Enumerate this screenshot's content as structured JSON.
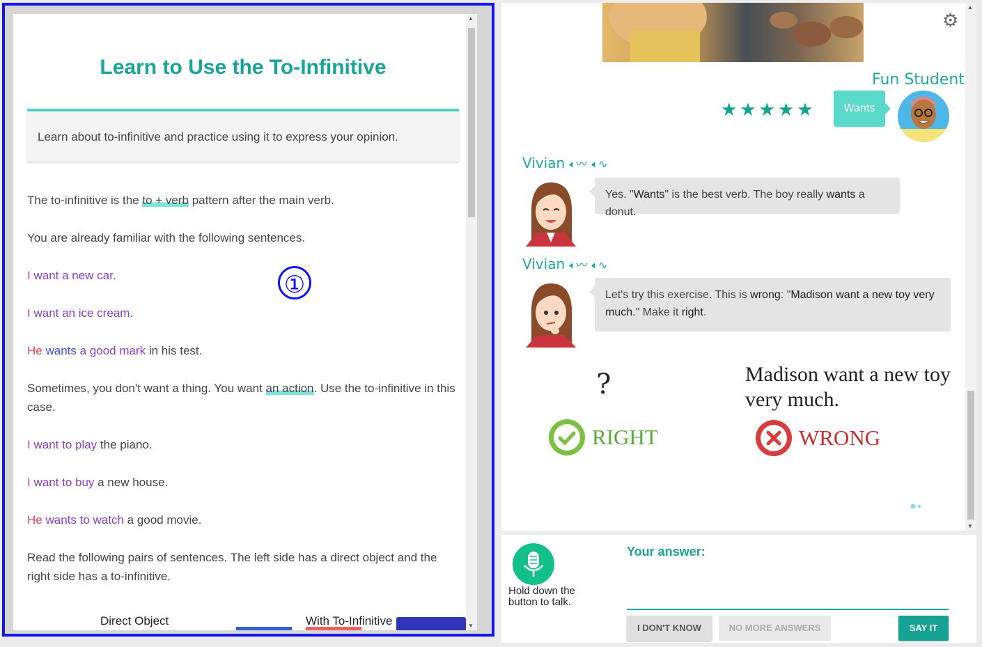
{
  "lesson": {
    "title": "Learn to Use the To-Infinitive",
    "summary": "Learn about to-infinitive and practice using it to express your opinion.",
    "p1_before": "The to-infinitive is the ",
    "p1_hl": "to + verb",
    "p1_after": " pattern after the main verb.",
    "p2": "You are already familiar with the following sentences.",
    "ex1_subject": "I",
    "ex1_rest": " want a new car.",
    "ex2_subject": "I",
    "ex2_rest": " want an ice cream.",
    "ex3_subject": "He",
    "ex3_verb": " wants",
    "ex3_obj": " a good mark",
    "ex3_rest": " in his test.",
    "p3_before": "Sometimes, you don't want a thing. You want ",
    "p3_hl": "an action",
    "p3_after": ". Use the to-infinitive in this case.",
    "ex4_subject": "I",
    "ex4_verb": " want to play",
    "ex4_rest": " the piano.",
    "ex5_subject": "I",
    "ex5_verb": " want to buy",
    "ex5_rest": " a new house.",
    "ex6_subject": "He",
    "ex6_verb": " wants to watch",
    "ex6_rest": " a good movie.",
    "p4": "Read the following pairs of sentences. The left side has a direct object and the right side has a to-infinitive.",
    "col_left": "Direct Object",
    "col_right": "With To-Infinitive",
    "marker": "①"
  },
  "chat": {
    "student_name": "Fun Student",
    "stars": "★★★★★",
    "rating": 5,
    "student_reply": "Wants",
    "tutor_name": "Vivian",
    "msg1_a": "Yes. \"",
    "msg1_b": "Wants",
    "msg1_c": "\" is the best verb. The boy really ",
    "msg1_d": "wants",
    "msg1_e": " a donut.",
    "msg2_a": "Let's try this exercise. This is ",
    "msg2_b": "wrong",
    "msg2_c": ": \"",
    "msg2_d": "Madison want a new toy very much.",
    "msg2_e": "\" Make it ",
    "msg2_f": "right",
    "msg2_g": "."
  },
  "exercise": {
    "question_mark": "?",
    "right_label": "RIGHT",
    "wrong_label": "WRONG",
    "sentence": "Madison want a new toy very much."
  },
  "answer": {
    "mic_hint": "Hold down the button to talk.",
    "label": "Your answer:",
    "value": "",
    "btn_dont_know": "I DON'T KNOW",
    "btn_no_more": "NO MORE ANSWERS",
    "btn_say_it": "SAY IT"
  },
  "colors": {
    "accent": "#19a596",
    "highlight": "#7fe3d9",
    "frame_blue": "#1414ee",
    "right_green": "#7bc043",
    "wrong_red": "#d83c3c"
  },
  "icons": [
    "settings-gear-icon",
    "speaker-normal-icon",
    "speaker-slow-icon",
    "microphone-icon",
    "check-icon",
    "x-icon"
  ]
}
